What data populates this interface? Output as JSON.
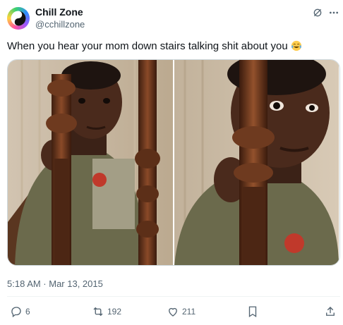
{
  "author": {
    "name": "Chill Zone",
    "handle": "@cchillzone"
  },
  "tweet": {
    "text": "When you hear your mom down stairs talking shit about you",
    "emoji": "face-with-tears-of-joy",
    "timestamp": "5:18 AM · Mar 13, 2015"
  },
  "header_icons": [
    "grok-icon",
    "more-icon"
  ],
  "metrics": {
    "replies": "6",
    "retweets": "192",
    "likes": "211"
  },
  "colors": {
    "text": "#0f1419",
    "secondary": "#536471",
    "border": "#cfd9de"
  }
}
